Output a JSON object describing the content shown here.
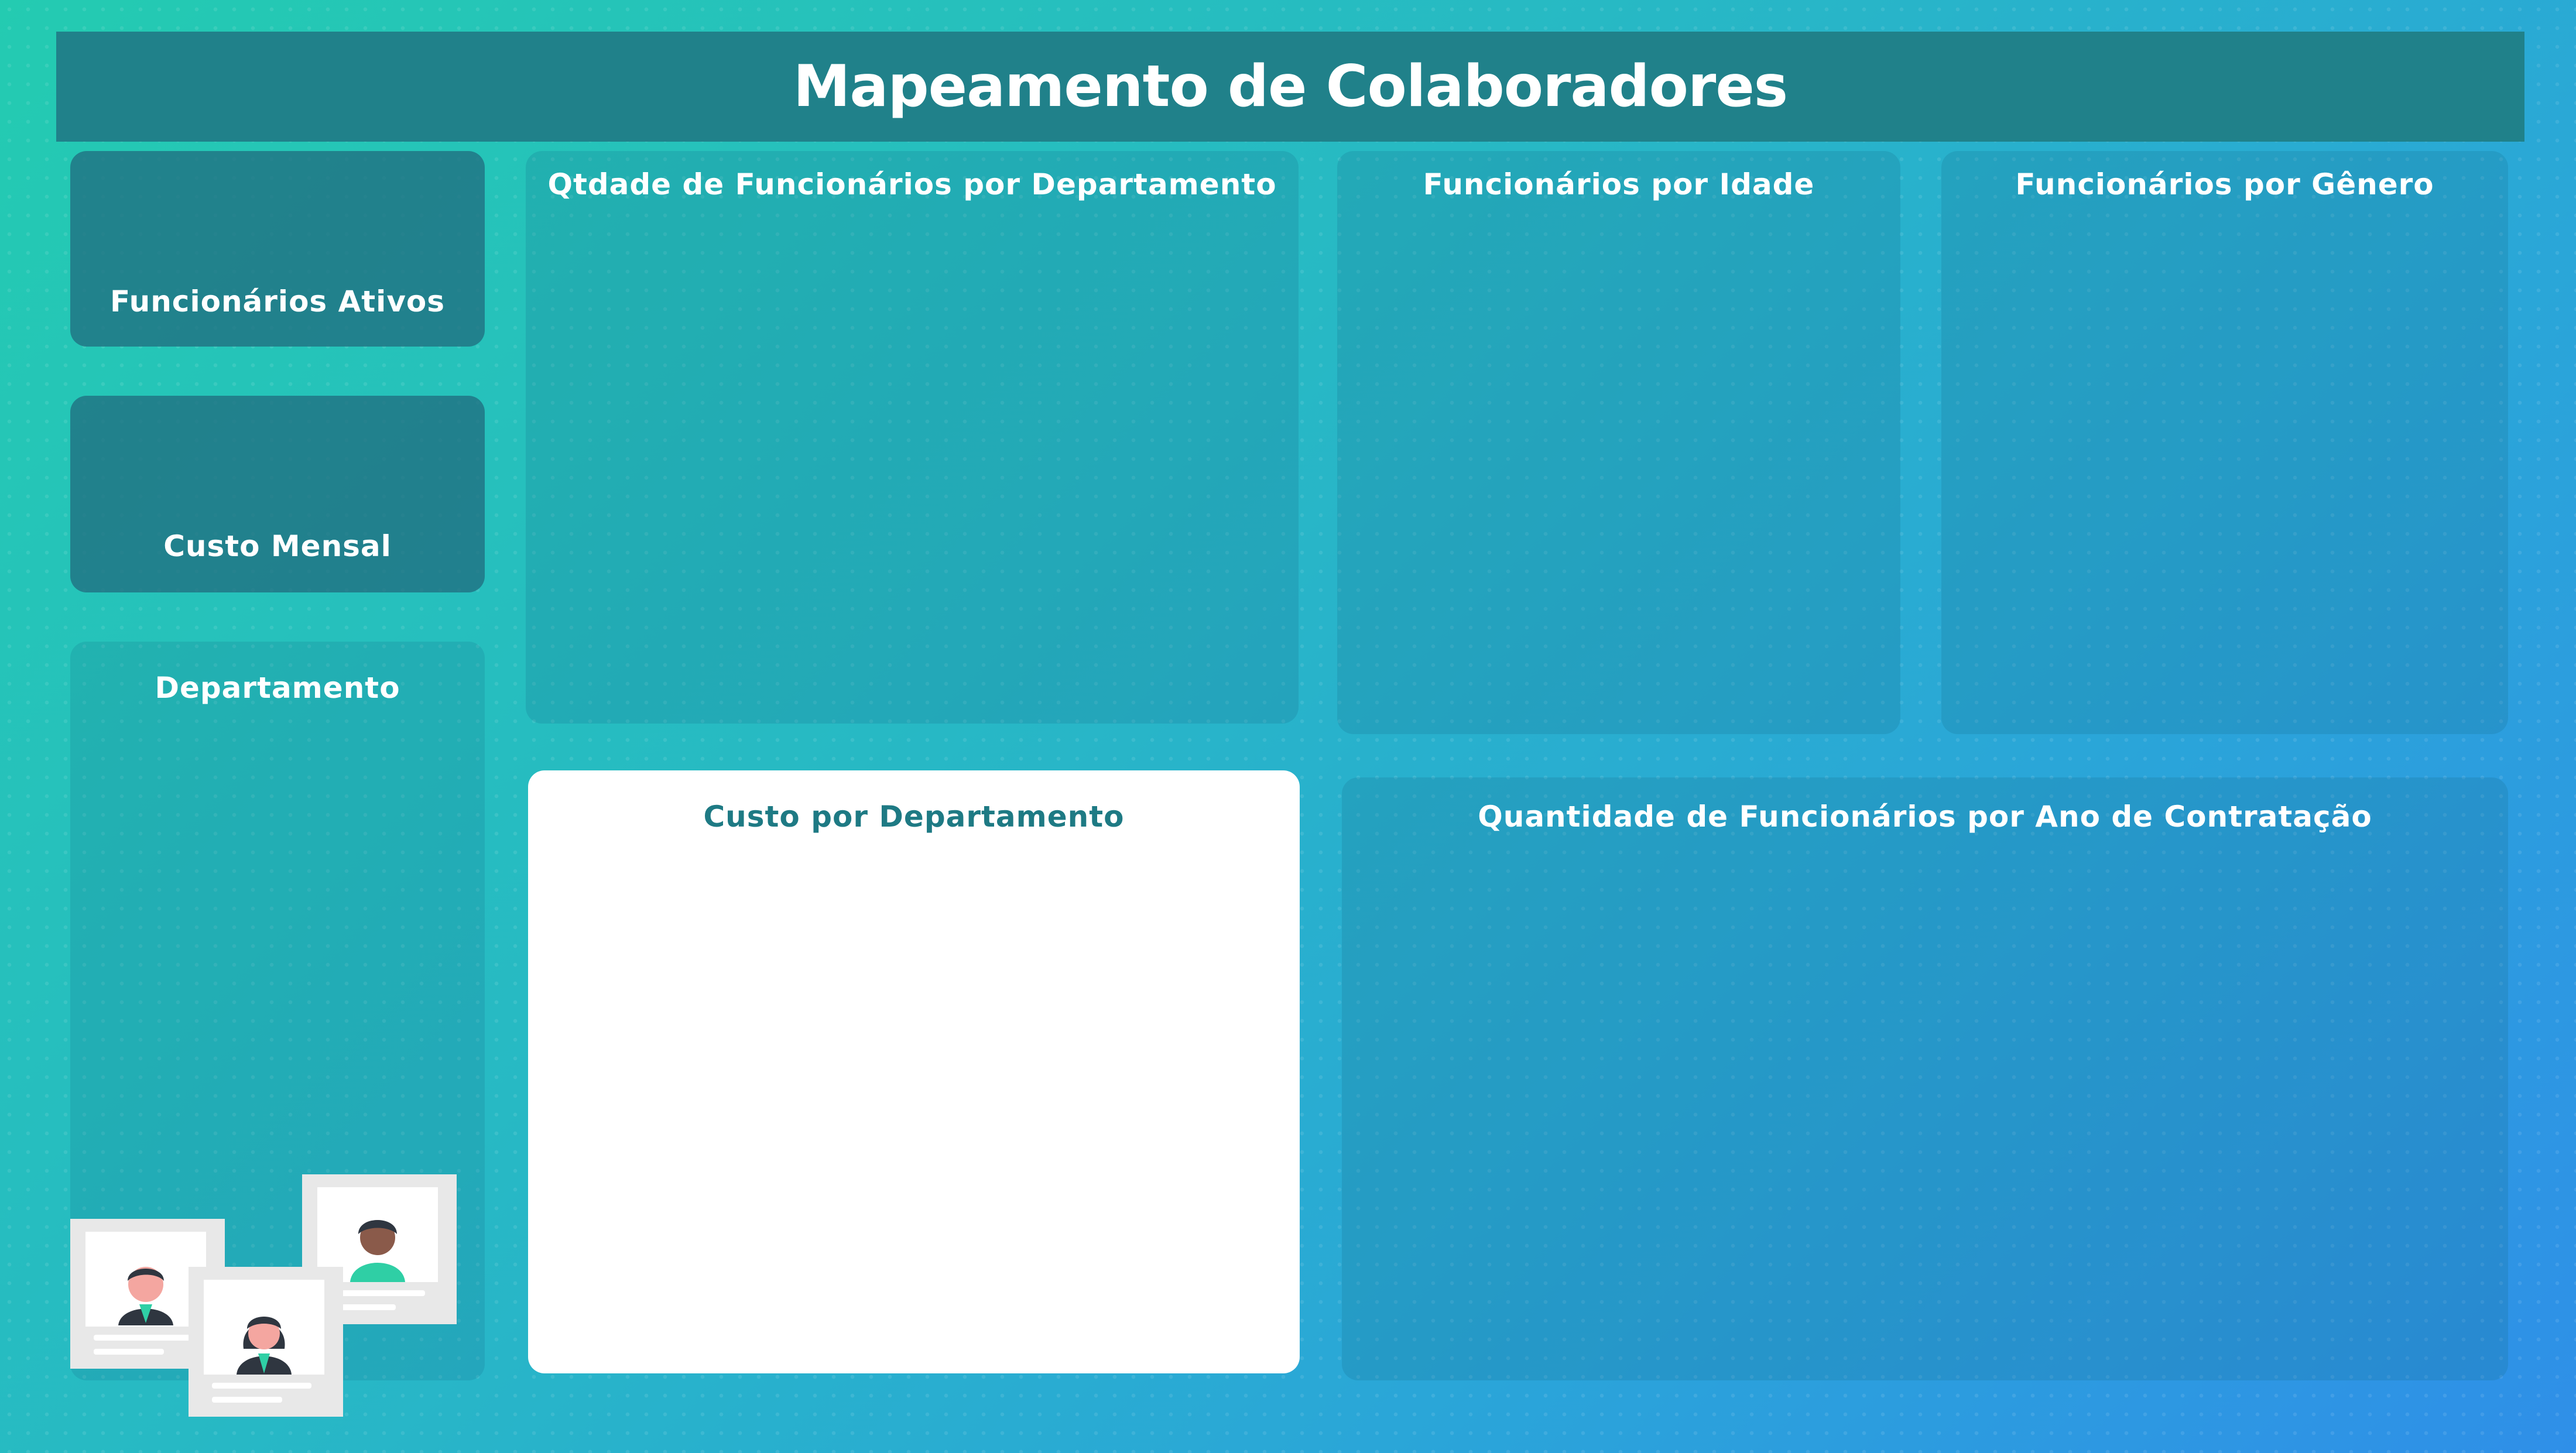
{
  "header": {
    "title": "Mapeamento de Colaboradores"
  },
  "kpis": {
    "active_label": "Funcionários Ativos",
    "cost_label": "Custo Mensal"
  },
  "slicer": {
    "title": "Departamento"
  },
  "charts": {
    "dept": "Qtdade de Funcionários por Departamento",
    "age": "Funcionários por Idade",
    "gender": "Funcionários por Gênero",
    "cost": "Custo por Departamento",
    "year": "Quantidade de Funcionários por Ano de Contratação"
  },
  "colors": {
    "header_bg": "#20818a",
    "cost_title": "#1e7a84",
    "accent_green": "#2fcfa5"
  },
  "icons": [
    "employee-card-male-icon",
    "employee-card-female-icon",
    "employee-card-dark-male-icon"
  ]
}
